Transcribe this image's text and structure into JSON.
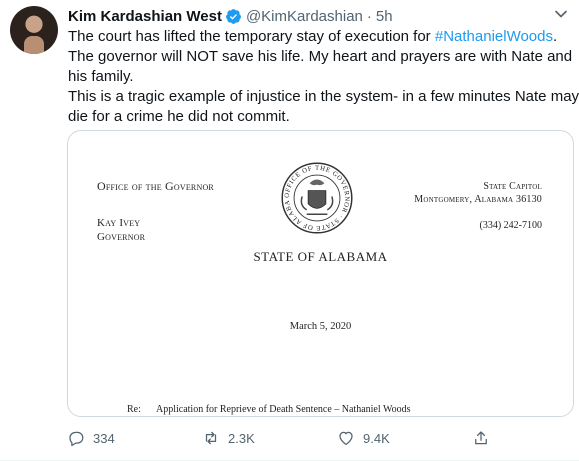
{
  "tweet": {
    "author_name": "Kim Kardashian West",
    "handle": "@KimKardashian",
    "separator": "·",
    "time": "5h",
    "verified": true,
    "text_lines": [
      {
        "before": "The court has lifted the temporary stay of execution for ",
        "hashtag": "#NathanielWoods",
        "after": "."
      },
      {
        "text": "The governor will NOT save his life. My heart and prayers are with Nate and"
      },
      {
        "text": "his family."
      },
      {
        "text": "This is a tragic example of injustice in the system- in a few minutes Nate may"
      },
      {
        "text": "die for a crime he did not commit."
      }
    ]
  },
  "letter": {
    "office": "Office of the Governor",
    "governor_name": "Kay Ivey",
    "governor_title": "Governor",
    "capitol": "State Capitol",
    "address": "Montgomery, Alabama 36130",
    "phone": "(334) 242-7100",
    "state_title": "STATE OF ALABAMA",
    "date": "March 5, 2020",
    "re_label": "Re:",
    "re_text": "Application for Reprieve of Death Sentence – Nathaniel Woods",
    "seal_text": "OFFICE OF THE GOVERNOR · STATE OF ALABAMA"
  },
  "actions": {
    "reply_count": "334",
    "retweet_count": "2.3K",
    "like_count": "9.4K"
  },
  "icons": {
    "verified": "verified-badge-icon",
    "more": "chevron-down-icon",
    "reply": "reply-icon",
    "retweet": "retweet-icon",
    "like": "heart-icon",
    "share": "share-icon"
  },
  "colors": {
    "link": "#1d9bf0",
    "secondary_text": "#536471",
    "border": "#cfd9de"
  }
}
